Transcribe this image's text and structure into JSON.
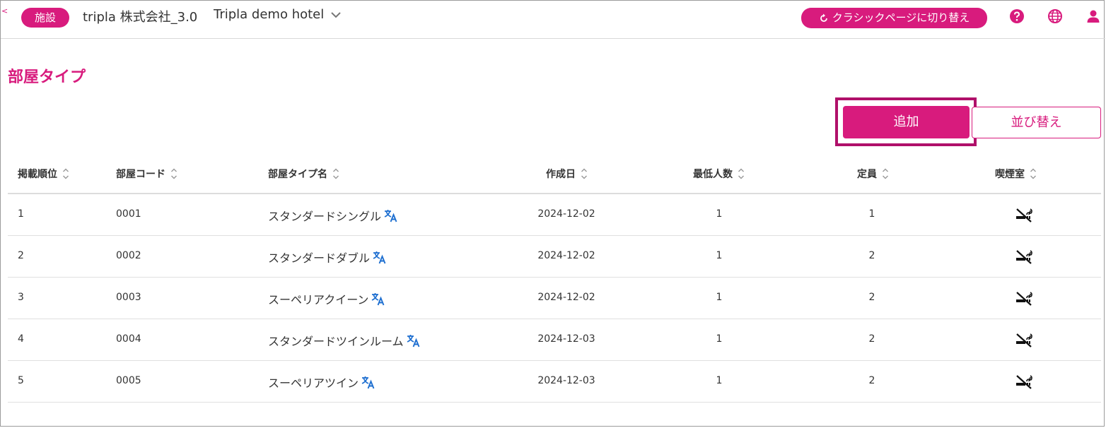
{
  "header": {
    "edge_glyph": "<",
    "facility_badge": "施設",
    "company_name": "tripla 株式会社_3.0",
    "hotel_name": "Tripla demo hotel",
    "classic_button_label": "クラシックページに切り替え"
  },
  "page": {
    "title": "部屋タイプ",
    "add_button_label": "追加",
    "sort_button_label": "並び替え"
  },
  "table": {
    "columns": [
      "掲載順位",
      "部屋コード",
      "部屋タイプ名",
      "作成日",
      "最低人数",
      "定員",
      "喫煙室"
    ],
    "rows": [
      {
        "order": "1",
        "code": "0001",
        "name": "スタンダードシングル",
        "created": "2024-12-02",
        "min_guests": "1",
        "capacity": "1",
        "smoking": "non-smoking"
      },
      {
        "order": "2",
        "code": "0002",
        "name": "スタンダードダブル",
        "created": "2024-12-02",
        "min_guests": "1",
        "capacity": "2",
        "smoking": "non-smoking"
      },
      {
        "order": "3",
        "code": "0003",
        "name": "スーペリアクイーン",
        "created": "2024-12-02",
        "min_guests": "1",
        "capacity": "2",
        "smoking": "non-smoking"
      },
      {
        "order": "4",
        "code": "0004",
        "name": "スタンダードツインルーム",
        "created": "2024-12-03",
        "min_guests": "1",
        "capacity": "2",
        "smoking": "non-smoking"
      },
      {
        "order": "5",
        "code": "0005",
        "name": "スーペリアツイン",
        "created": "2024-12-03",
        "min_guests": "1",
        "capacity": "2",
        "smoking": "non-smoking"
      }
    ]
  },
  "icons": {
    "hotel_chevron": "chevron-down-icon",
    "classic_switch": "refresh-icon",
    "help": "help-icon",
    "language": "globe-icon",
    "account": "user-icon",
    "sort": "sort-icon",
    "translate": "translate-icon",
    "smoking": "no-smoking-icon"
  },
  "colors": {
    "accent": "#d81b7d",
    "highlight_outline": "#b0106a",
    "translate_icon": "#1e6fd0"
  }
}
